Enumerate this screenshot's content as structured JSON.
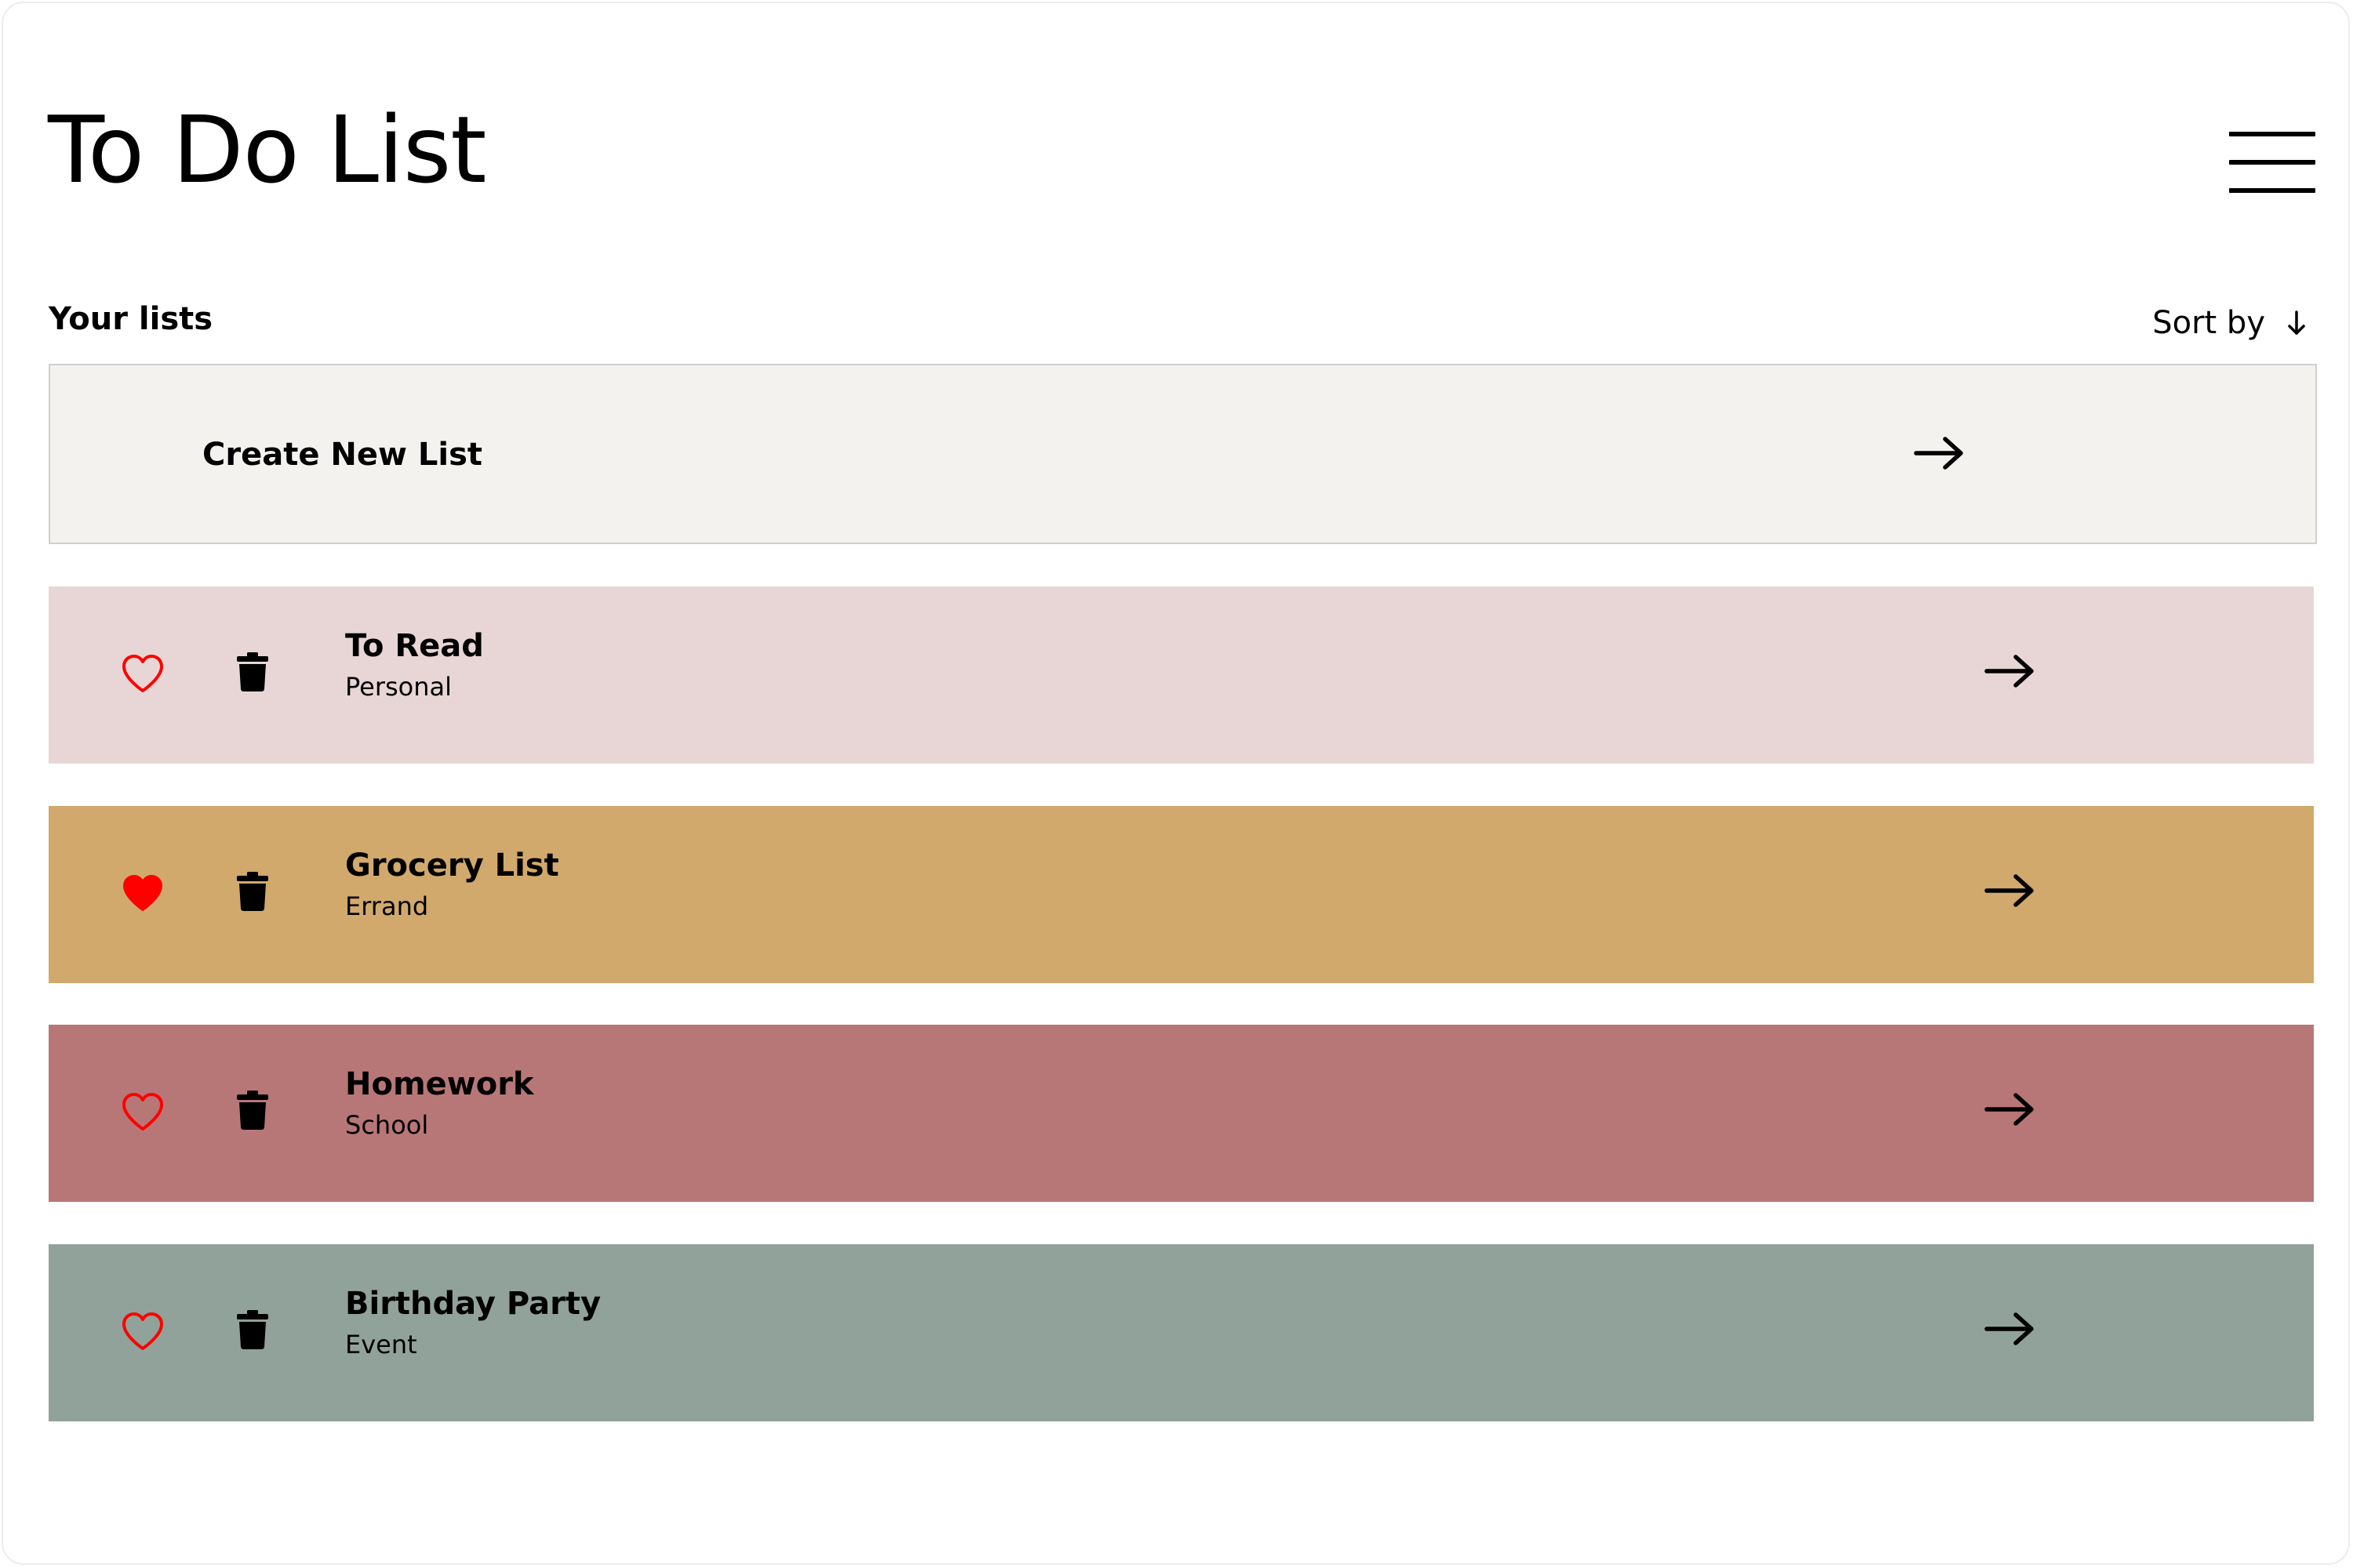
{
  "app": {
    "title": "To Do List"
  },
  "section": {
    "label": "Your lists",
    "sort_label": "Sort by"
  },
  "create": {
    "label": "Create New List"
  },
  "lists": [
    {
      "title": "To Read",
      "category": "Personal",
      "favorited": false,
      "color": "#e8d6d6"
    },
    {
      "title": "Grocery List",
      "category": "Errand",
      "favorited": true,
      "color": "#d2a96c"
    },
    {
      "title": "Homework",
      "category": "School",
      "favorited": false,
      "color": "#b87777"
    },
    {
      "title": "Birthday Party",
      "category": "Event",
      "favorited": false,
      "color": "#91a29a"
    }
  ],
  "colors": {
    "heart": "#ff0000",
    "create_card_bg": "#f3f2ef"
  },
  "icons": {
    "menu": "hamburger-menu-icon",
    "sort": "arrow-down-icon",
    "open": "arrow-right-icon",
    "favorite": "heart-icon",
    "delete": "trash-icon"
  }
}
